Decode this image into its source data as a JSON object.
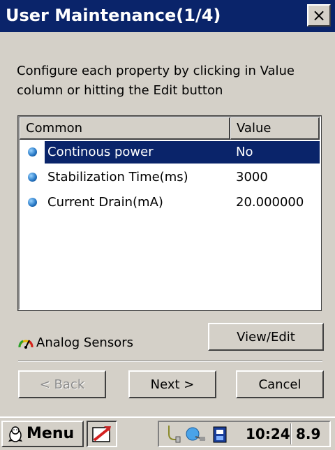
{
  "window": {
    "title": "User Maintenance(1/4)",
    "close_glyph": "×",
    "instructions": "Configure each property by clicking in Value column or hitting the Edit button"
  },
  "grid": {
    "columns": [
      "Common",
      "Value"
    ],
    "rows": [
      {
        "name": "Continous power",
        "value": "No",
        "selected": true,
        "icon": "blue-bullet-icon"
      },
      {
        "name": "Stabilization Time(ms)",
        "value": "3000",
        "selected": false,
        "icon": "blue-bullet-icon"
      },
      {
        "name": "Current Drain(mA)",
        "value": "20.000000",
        "selected": false,
        "icon": "blue-bullet-icon"
      }
    ]
  },
  "sensors": {
    "label": "Analog Sensors",
    "icon": "gauge-icon",
    "view_edit_label": "View/Edit"
  },
  "wizard": {
    "back_label": "< Back",
    "next_label": "Next >",
    "cancel_label": "Cancel"
  },
  "taskbar": {
    "menu_label": "Menu",
    "clock": "10:24",
    "battery_text": "8.9",
    "icons": [
      "start-penguin-icon",
      "app-task-icon",
      "usb-connection-icon",
      "network-icon",
      "storage-card-icon"
    ]
  },
  "colors": {
    "title_bar": "#0a246a",
    "selection": "#0a246a",
    "face": "#d4d0c8"
  }
}
